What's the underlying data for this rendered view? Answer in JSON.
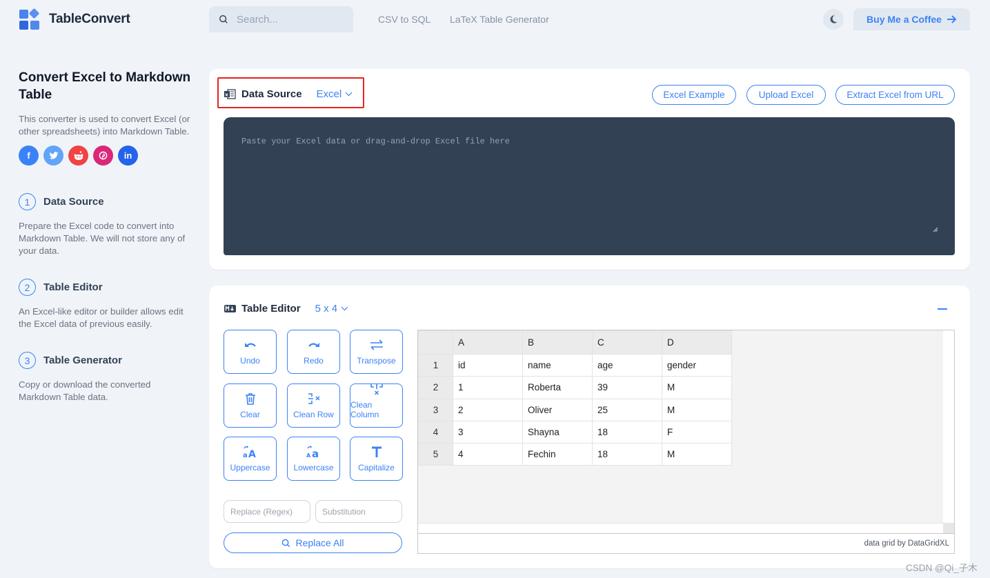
{
  "header": {
    "brand": "TableConvert",
    "search_placeholder": "Search...",
    "nav_links": [
      "CSV to SQL",
      "LaTeX Table Generator"
    ],
    "theme_toggle_icon": "moon-icon",
    "coffee_label": "Buy Me a Coffee"
  },
  "sidebar": {
    "title": "Convert Excel to Markdown Table",
    "description": "This converter is used to convert Excel (or other spreadsheets) into Markdown Table.",
    "social": [
      {
        "name": "facebook",
        "glyph": "f",
        "color": "#3b82f6"
      },
      {
        "name": "twitter",
        "glyph": "t",
        "color": "#60a5fa"
      },
      {
        "name": "reddit",
        "glyph": "r",
        "color": "#ef4444"
      },
      {
        "name": "pinterest",
        "glyph": "p",
        "color": "#db2777"
      },
      {
        "name": "linkedin",
        "glyph": "in",
        "color": "#2563eb"
      }
    ],
    "steps": [
      {
        "num": "1",
        "title": "Data Source",
        "desc": "Prepare the Excel code to convert into Markdown Table. We will not store any of your data."
      },
      {
        "num": "2",
        "title": "Table Editor",
        "desc": "An Excel-like editor or builder allows edit the Excel data of previous easily."
      },
      {
        "num": "3",
        "title": "Table Generator",
        "desc": "Copy or download the converted Markdown Table data."
      }
    ]
  },
  "data_source": {
    "title": "Data Source",
    "format": "Excel",
    "buttons": [
      "Excel Example",
      "Upload Excel",
      "Extract Excel from URL"
    ],
    "textarea_placeholder": "Paste your Excel data or drag-and-drop Excel file here",
    "textarea_value": ""
  },
  "table_editor": {
    "title": "Table Editor",
    "size": "5 x 4",
    "tools": [
      "Undo",
      "Redo",
      "Transpose",
      "Clear",
      "Clean Row",
      "Clean Column",
      "Uppercase",
      "Lowercase",
      "Capitalize"
    ],
    "replace_placeholder": "Replace (Regex)",
    "substitution_placeholder": "Substitution",
    "replace_all_label": "Replace All",
    "grid": {
      "columns": [
        "A",
        "B",
        "C",
        "D"
      ],
      "rows": [
        {
          "num": "1",
          "cells": [
            "id",
            "name",
            "age",
            "gender"
          ]
        },
        {
          "num": "2",
          "cells": [
            "1",
            "Roberta",
            "39",
            "M"
          ]
        },
        {
          "num": "3",
          "cells": [
            "2",
            "Oliver",
            "25",
            "M"
          ]
        },
        {
          "num": "4",
          "cells": [
            "3",
            "Shayna",
            "18",
            "F"
          ]
        },
        {
          "num": "5",
          "cells": [
            "4",
            "Fechin",
            "18",
            "M"
          ]
        }
      ],
      "footer": "data grid by DataGridXL"
    }
  },
  "colors": {
    "accent": "#3b82f6",
    "highlight_box": "#e5211e",
    "textarea_bg": "#334155",
    "page_bg": "#f0f4f9"
  },
  "watermark": "CSDN @Qi_子木"
}
